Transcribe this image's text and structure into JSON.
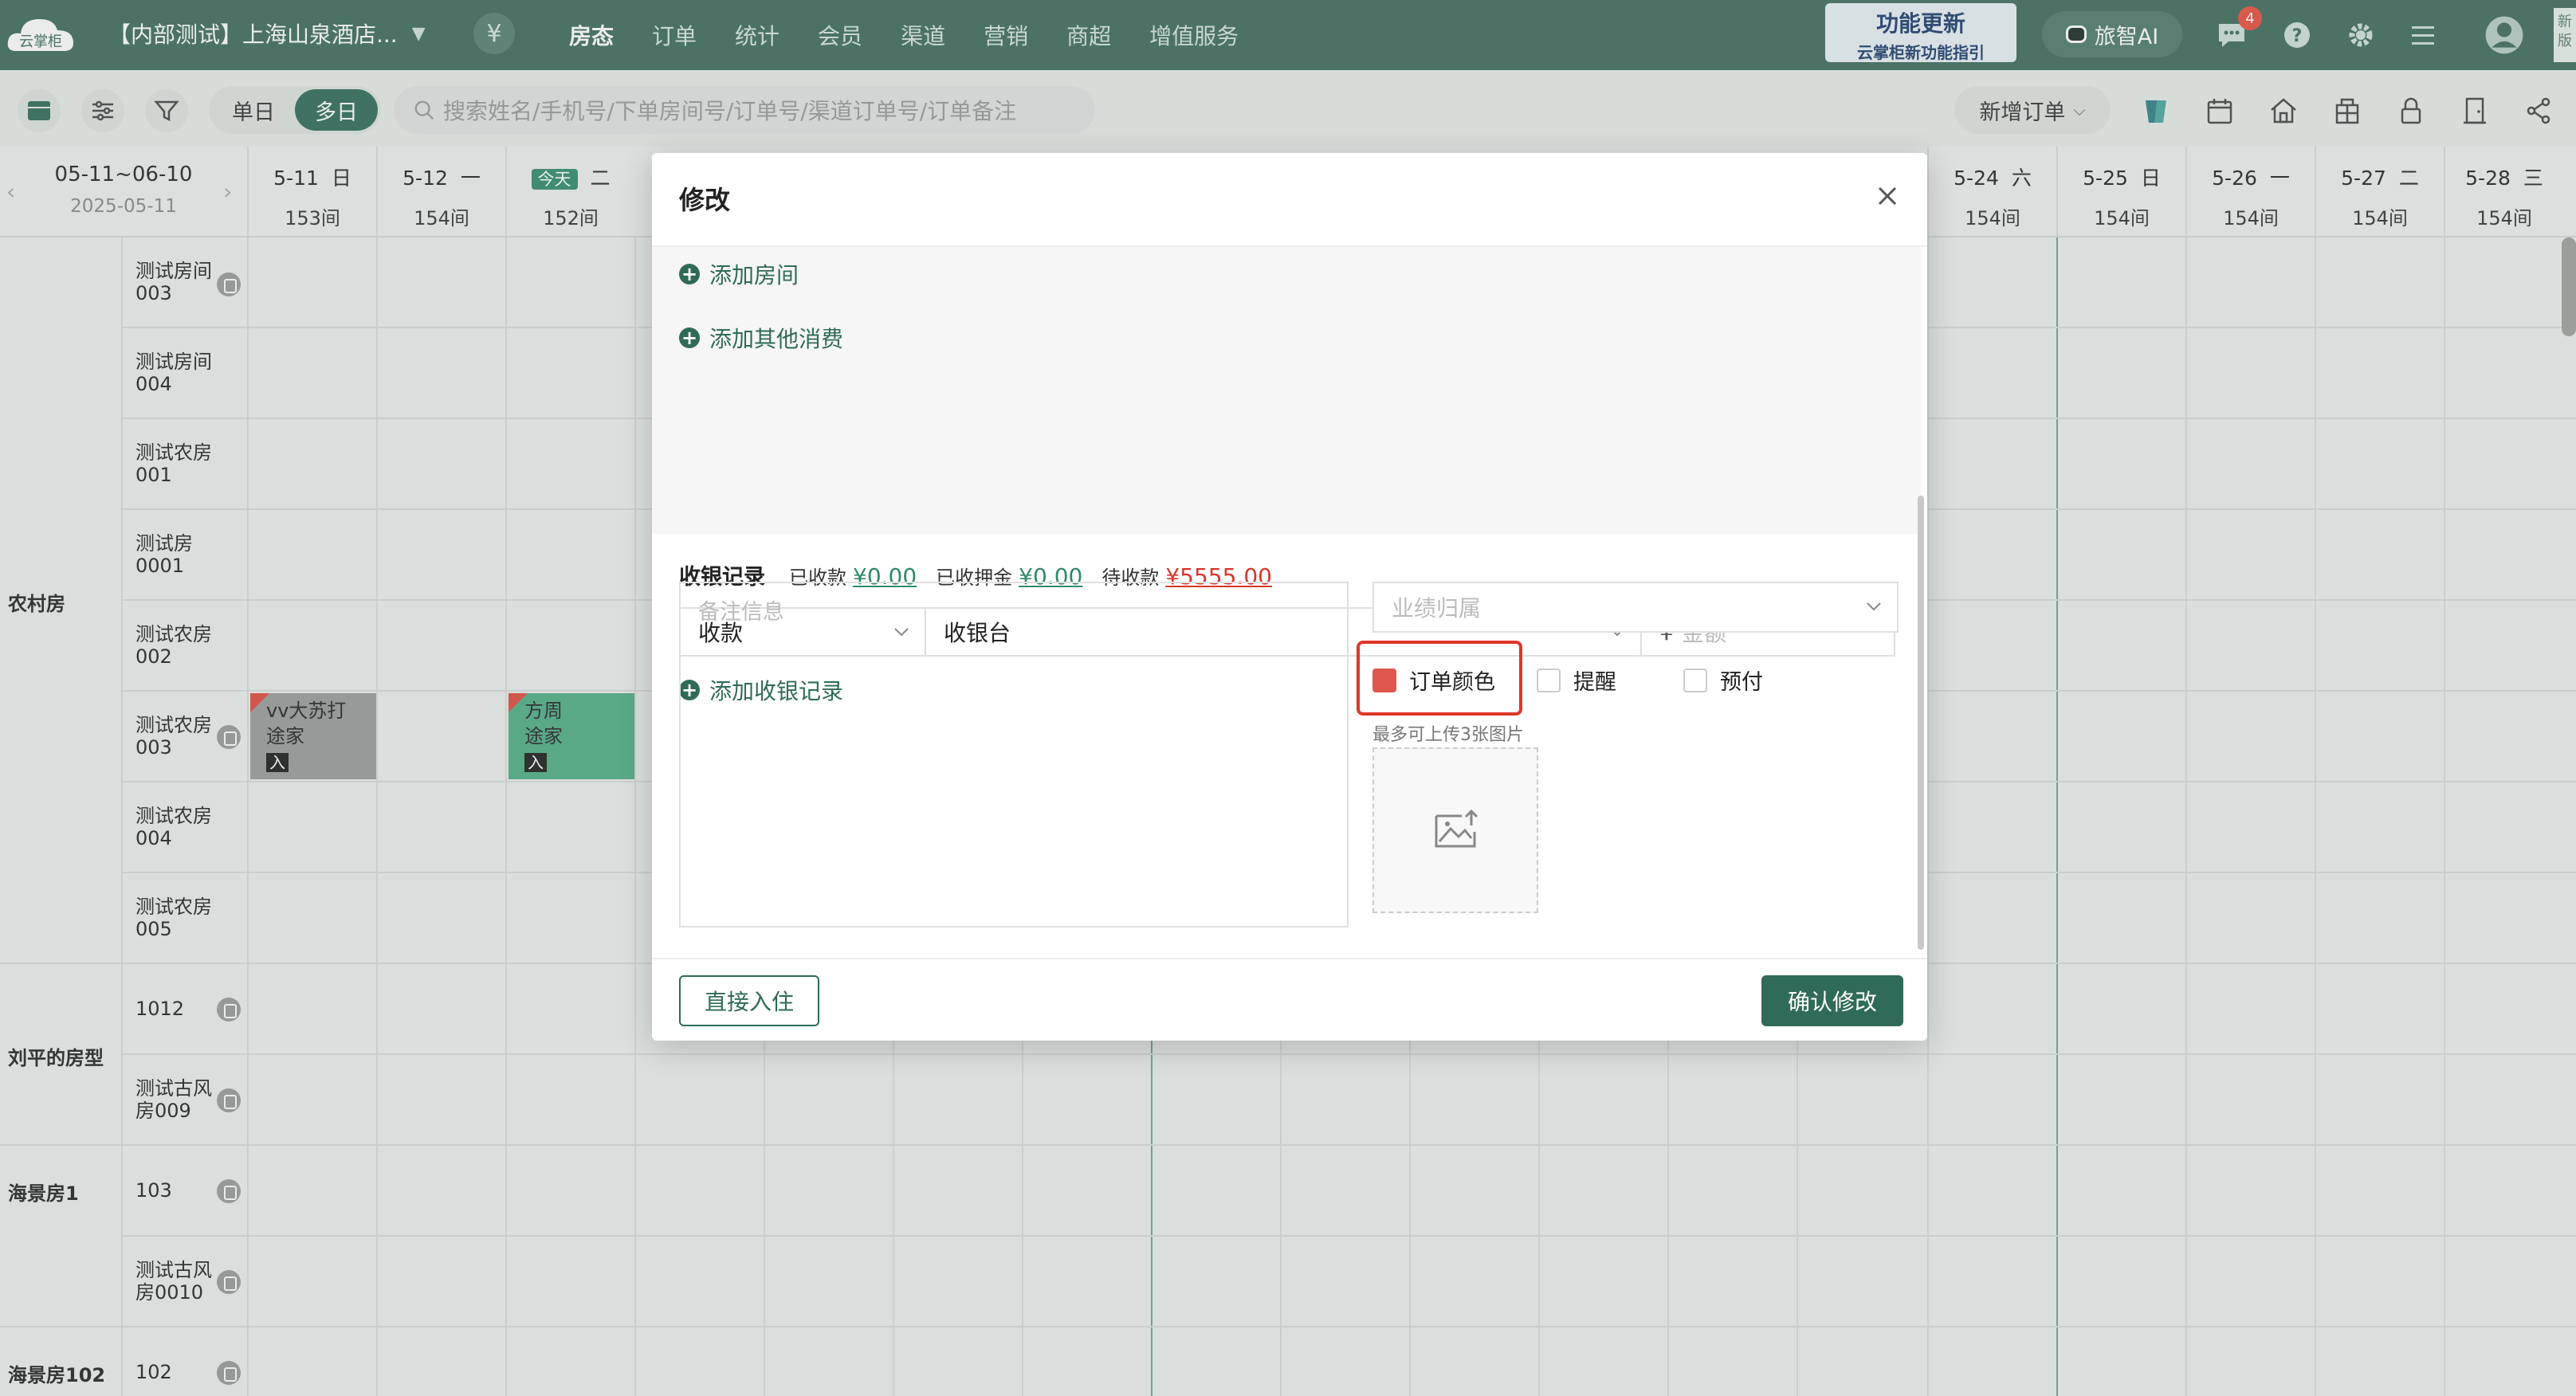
{
  "topbar": {
    "logo_text": "云掌柜",
    "hotel_name": "【内部测试】上海山泉酒店...",
    "nav": [
      "房态",
      "订单",
      "统计",
      "会员",
      "渠道",
      "营销",
      "商超",
      "增值服务"
    ],
    "promo_title": "功能更新",
    "promo_sub": "云掌柜新功能指引",
    "ai_label": "旅智AI",
    "msg_badge": "4",
    "version_tag": "新版"
  },
  "toolbar": {
    "mode_single": "单日",
    "mode_multi": "多日",
    "search_placeholder": "搜索姓名/手机号/下单房间号/订单号/渠道订单号/订单备注",
    "new_order": "新增订单"
  },
  "calendar": {
    "range": "05-11~06-10",
    "date": "2025-05-11",
    "today_label": "今天",
    "days": [
      {
        "date": "5-11",
        "week": "日",
        "count": "153间"
      },
      {
        "date": "5-12",
        "week": "一",
        "count": "154间"
      },
      {
        "date": "",
        "week": "二",
        "count": "152间"
      },
      {
        "date": "5-24",
        "week": "六",
        "count": "154间"
      },
      {
        "date": "5-25",
        "week": "日",
        "count": "154间"
      },
      {
        "date": "5-26",
        "week": "一",
        "count": "154间"
      },
      {
        "date": "5-27",
        "week": "二",
        "count": "154间"
      },
      {
        "date": "5-28",
        "week": "三",
        "count": "154间"
      }
    ]
  },
  "rooms": {
    "types": [
      "农村房",
      "刘平的房型",
      "海景房1",
      "海景房102"
    ],
    "list": [
      "测试房间003",
      "测试房间004",
      "测试农房001",
      "测试房0001",
      "测试农房002",
      "测试农房003",
      "测试农房004",
      "测试农房005",
      "1012",
      "测试古风房009",
      "103",
      "测试古风房0010",
      "102"
    ]
  },
  "bookings": [
    {
      "name": "vv大苏打",
      "source": "途家",
      "tag": "入"
    },
    {
      "name": "方周",
      "source": "途家",
      "tag": "入"
    }
  ],
  "modal": {
    "title": "修改",
    "add_room": "添加房间",
    "add_other": "添加其他消费",
    "cash_label": "收银记录",
    "received_label": "已收款",
    "received_value": "¥0.00",
    "deposit_label": "已收押金",
    "deposit_value": "¥0.00",
    "pending_label": "待收款",
    "pending_value": "¥5555.00",
    "pay_type": "收款",
    "pay_channel": "收银台",
    "amount_prefix": "¥",
    "amount_placeholder": "金额",
    "add_cash": "添加收银记录",
    "remark_placeholder": "备注信息",
    "perf_placeholder": "业绩归属",
    "order_color": "订单颜色",
    "remind": "提醒",
    "prepay": "预付",
    "upload_hint": "最多可上传3张图片",
    "btn_checkin": "直接入住",
    "btn_confirm": "确认修改"
  },
  "colors": {
    "brand": "#3d6b5c",
    "accent": "#2f6b58",
    "highlight": "#e0362a",
    "pending": "#d9362b"
  }
}
